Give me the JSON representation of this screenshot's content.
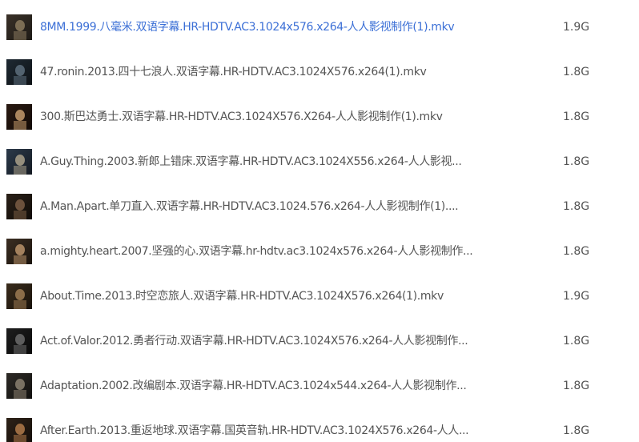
{
  "files": [
    {
      "name": "8MM.1999.八毫米.双语字幕.HR-HDTV.AC3.1024x576.x264-人人影视制作(1).mkv",
      "size": "1.9G",
      "highlight": true,
      "thumb": [
        "#3a3128",
        "#8b7a5e",
        "#1d1a16"
      ]
    },
    {
      "name": "47.ronin.2013.四十七浪人.双语字幕.HR-HDTV.AC3.1024X576.x264(1).mkv",
      "size": "1.8G",
      "highlight": false,
      "thumb": [
        "#1f2a33",
        "#5d6f7d",
        "#0e1216"
      ]
    },
    {
      "name": "300.斯巴达勇士.双语字幕.HR-HDTV.AC3.1024X576.X264-人人影视制作(1).mkv",
      "size": "1.8G",
      "highlight": false,
      "thumb": [
        "#2a1a12",
        "#c49a6c",
        "#120a06"
      ]
    },
    {
      "name": "A.Guy.Thing.2003.新郎上错床.双语字幕.HR-HDTV.AC3.1024X556.x264-人人影视...",
      "size": "1.8G",
      "highlight": false,
      "thumb": [
        "#2c3a4a",
        "#a9a08a",
        "#141a22"
      ]
    },
    {
      "name": "A.Man.Apart.单刀直入.双语字幕.HR-HDTV.AC3.1024.576.x264-人人影视制作(1)....",
      "size": "1.8G",
      "highlight": false,
      "thumb": [
        "#2a2018",
        "#7a5c44",
        "#100c08"
      ]
    },
    {
      "name": "a.mighty.heart.2007.坚强的心.双语字幕.hr-hdtv.ac3.1024x576.x264-人人影视制作...",
      "size": "1.8G",
      "highlight": false,
      "thumb": [
        "#3b2e22",
        "#b8926a",
        "#1a130d"
      ]
    },
    {
      "name": "About.Time.2013.时空恋旅人.双语字幕.HR-HDTV.AC3.1024X576.x264(1).mkv",
      "size": "1.9G",
      "highlight": false,
      "thumb": [
        "#3a2c1c",
        "#9c7a52",
        "#18120b"
      ]
    },
    {
      "name": "Act.of.Valor.2012.勇者行动.双语字幕.HR-HDTV.AC3.1024X576.x264-人人影视制作...",
      "size": "1.8G",
      "highlight": false,
      "thumb": [
        "#1e1e1e",
        "#6b6b6b",
        "#0a0a0a"
      ]
    },
    {
      "name": "Adaptation.2002.改编剧本.双语字幕.HR-HDTV.AC3.1024x544.x264-人人影视制作...",
      "size": "1.8G",
      "highlight": false,
      "thumb": [
        "#2d2a26",
        "#8a8070",
        "#12110f"
      ]
    },
    {
      "name": "After.Earth.2013.重返地球.双语字幕.国英音轨.HR-HDTV.AC3.1024X576.x264-人人...",
      "size": "1.8G",
      "highlight": false,
      "thumb": [
        "#2e2218",
        "#b07a4a",
        "#140e09"
      ]
    }
  ]
}
